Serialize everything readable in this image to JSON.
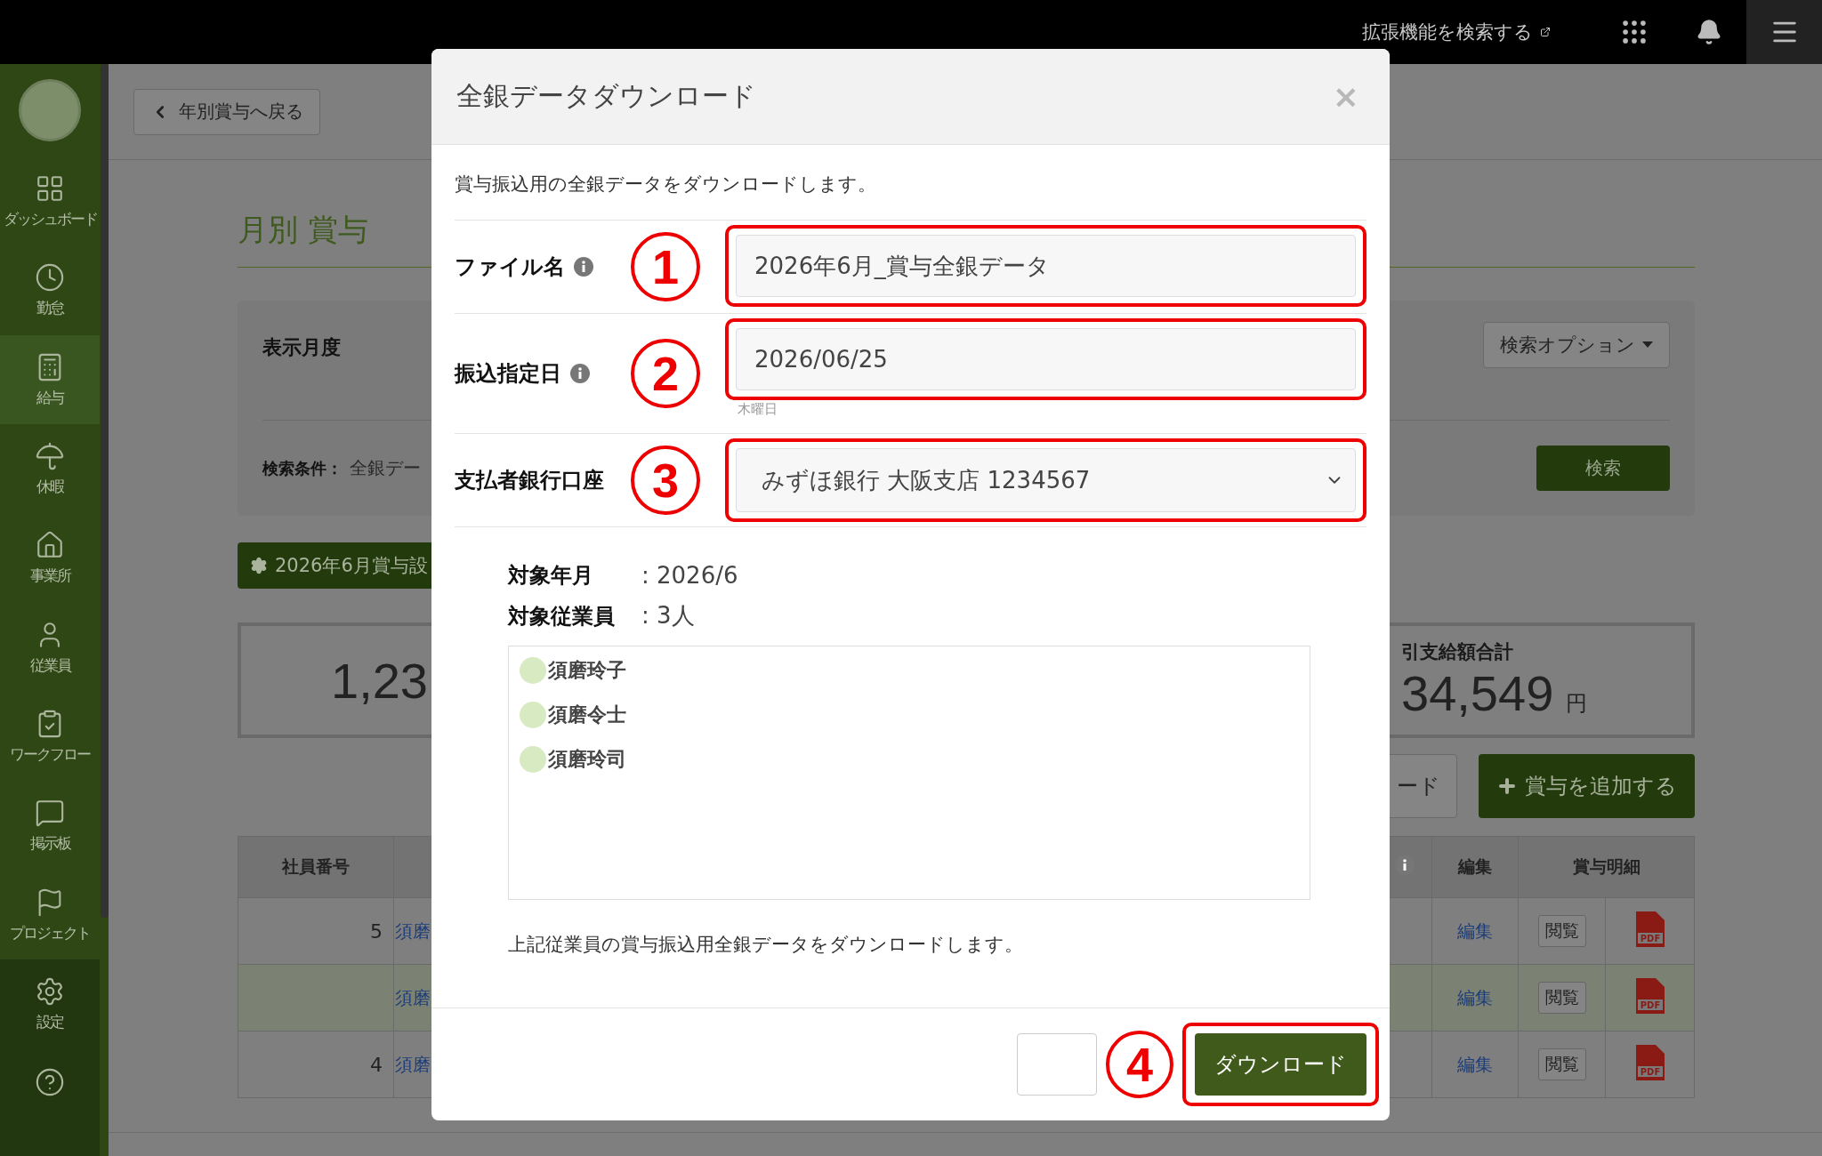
{
  "topbar": {
    "extension_link": "拡張機能を検索する"
  },
  "sidebar": {
    "items": [
      {
        "label": "ダッシュボード",
        "selected": false
      },
      {
        "label": "勤怠",
        "selected": false
      },
      {
        "label": "給与",
        "selected": true
      },
      {
        "label": "休暇",
        "selected": false
      },
      {
        "label": "事業所",
        "selected": false
      },
      {
        "label": "従業員",
        "selected": false
      },
      {
        "label": "ワークフロー",
        "selected": false
      },
      {
        "label": "掲示板",
        "selected": false
      },
      {
        "label": "プロジェクト",
        "selected": false
      }
    ],
    "footer_items": [
      {
        "label": "設定"
      }
    ]
  },
  "page": {
    "back_button": "年別賞与へ戻る",
    "title": "月別 賞与",
    "search_panel": {
      "month_label": "表示月度",
      "criteria_label": "検索条件：",
      "criteria_value": "全銀デー",
      "options_button": "検索オプション",
      "search_button": "検索"
    },
    "settings_button": "2026年6月賞与設",
    "summary_cards": [
      {
        "amount": "1,23"
      },
      {
        "label": "引支給額合計",
        "amount": "34,549",
        "unit": "円"
      }
    ],
    "action_buttons": [
      {
        "label": "ード",
        "kind": "outline"
      },
      {
        "label": "賞与を追加する",
        "kind": "add"
      }
    ],
    "table": {
      "columns": [
        "社員番号",
        "編集",
        "賞与明細"
      ],
      "rows": [
        {
          "number": "5",
          "name": "須磨",
          "edit": "編集",
          "view": "閲覧",
          "file_type": "PDF",
          "highlighted": false
        },
        {
          "name": "須磨",
          "edit": "編集",
          "view": "閲覧",
          "file_type": "PDF",
          "highlighted": true
        },
        {
          "number": "4",
          "name": "須磨",
          "edit": "編集",
          "view": "閲覧",
          "file_type": "PDF",
          "highlighted": false
        }
      ]
    }
  },
  "modal": {
    "title": "全銀データダウンロード",
    "close": "×",
    "intro": "賞与振込用の全銀データをダウンロードします。",
    "fields": [
      {
        "label": "ファイル名",
        "info": true,
        "marker": "1",
        "kind": "text",
        "value": "2026年6月_賞与全銀データ"
      },
      {
        "label": "振込指定日",
        "info": true,
        "marker": "2",
        "kind": "text",
        "value": "2026/06/25",
        "hint": "木曜日"
      },
      {
        "label": "支払者銀行口座",
        "info": false,
        "marker": "3",
        "kind": "select",
        "value": "みずほ銀行 大阪支店 1234567"
      }
    ],
    "summary": [
      {
        "label": "対象年月",
        "value": ": 2026/6"
      },
      {
        "label": "対象従業員",
        "value": ": 3人"
      }
    ],
    "employees": [
      "須磨玲子",
      "須磨令士",
      "須磨玲司"
    ],
    "note": "上記従業員の賞与振込用全銀データをダウンロードします。",
    "download_button": {
      "label": "ダウンロード",
      "marker": "4"
    }
  }
}
